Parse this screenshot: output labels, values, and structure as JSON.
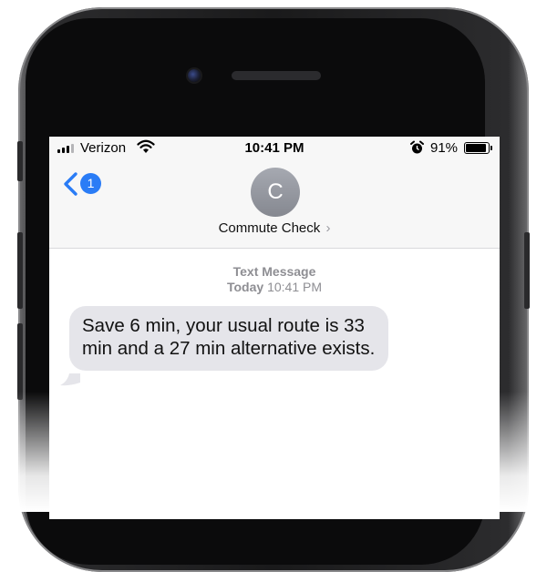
{
  "status_bar": {
    "carrier": "Verizon",
    "time": "10:41 PM",
    "battery_percent": "91%",
    "battery_level": 0.91,
    "icons": [
      "signal-bars-icon",
      "wifi-icon",
      "alarm-clock-icon",
      "battery-icon"
    ]
  },
  "header": {
    "back_badge_count": "1",
    "avatar_initial": "C",
    "contact_name": "Commute Check",
    "contact_chevron": "›"
  },
  "conversation": {
    "service_label": "Text Message",
    "day": "Today",
    "time": "10:41 PM",
    "messages": [
      {
        "direction": "incoming",
        "text": "Save 6 min, your usual route is 33 min and a 27 min alternative exists."
      }
    ]
  },
  "colors": {
    "accent": "#2a7cf6",
    "incoming_bubble": "#e5e5ea",
    "meta_text": "#8e8e93"
  }
}
